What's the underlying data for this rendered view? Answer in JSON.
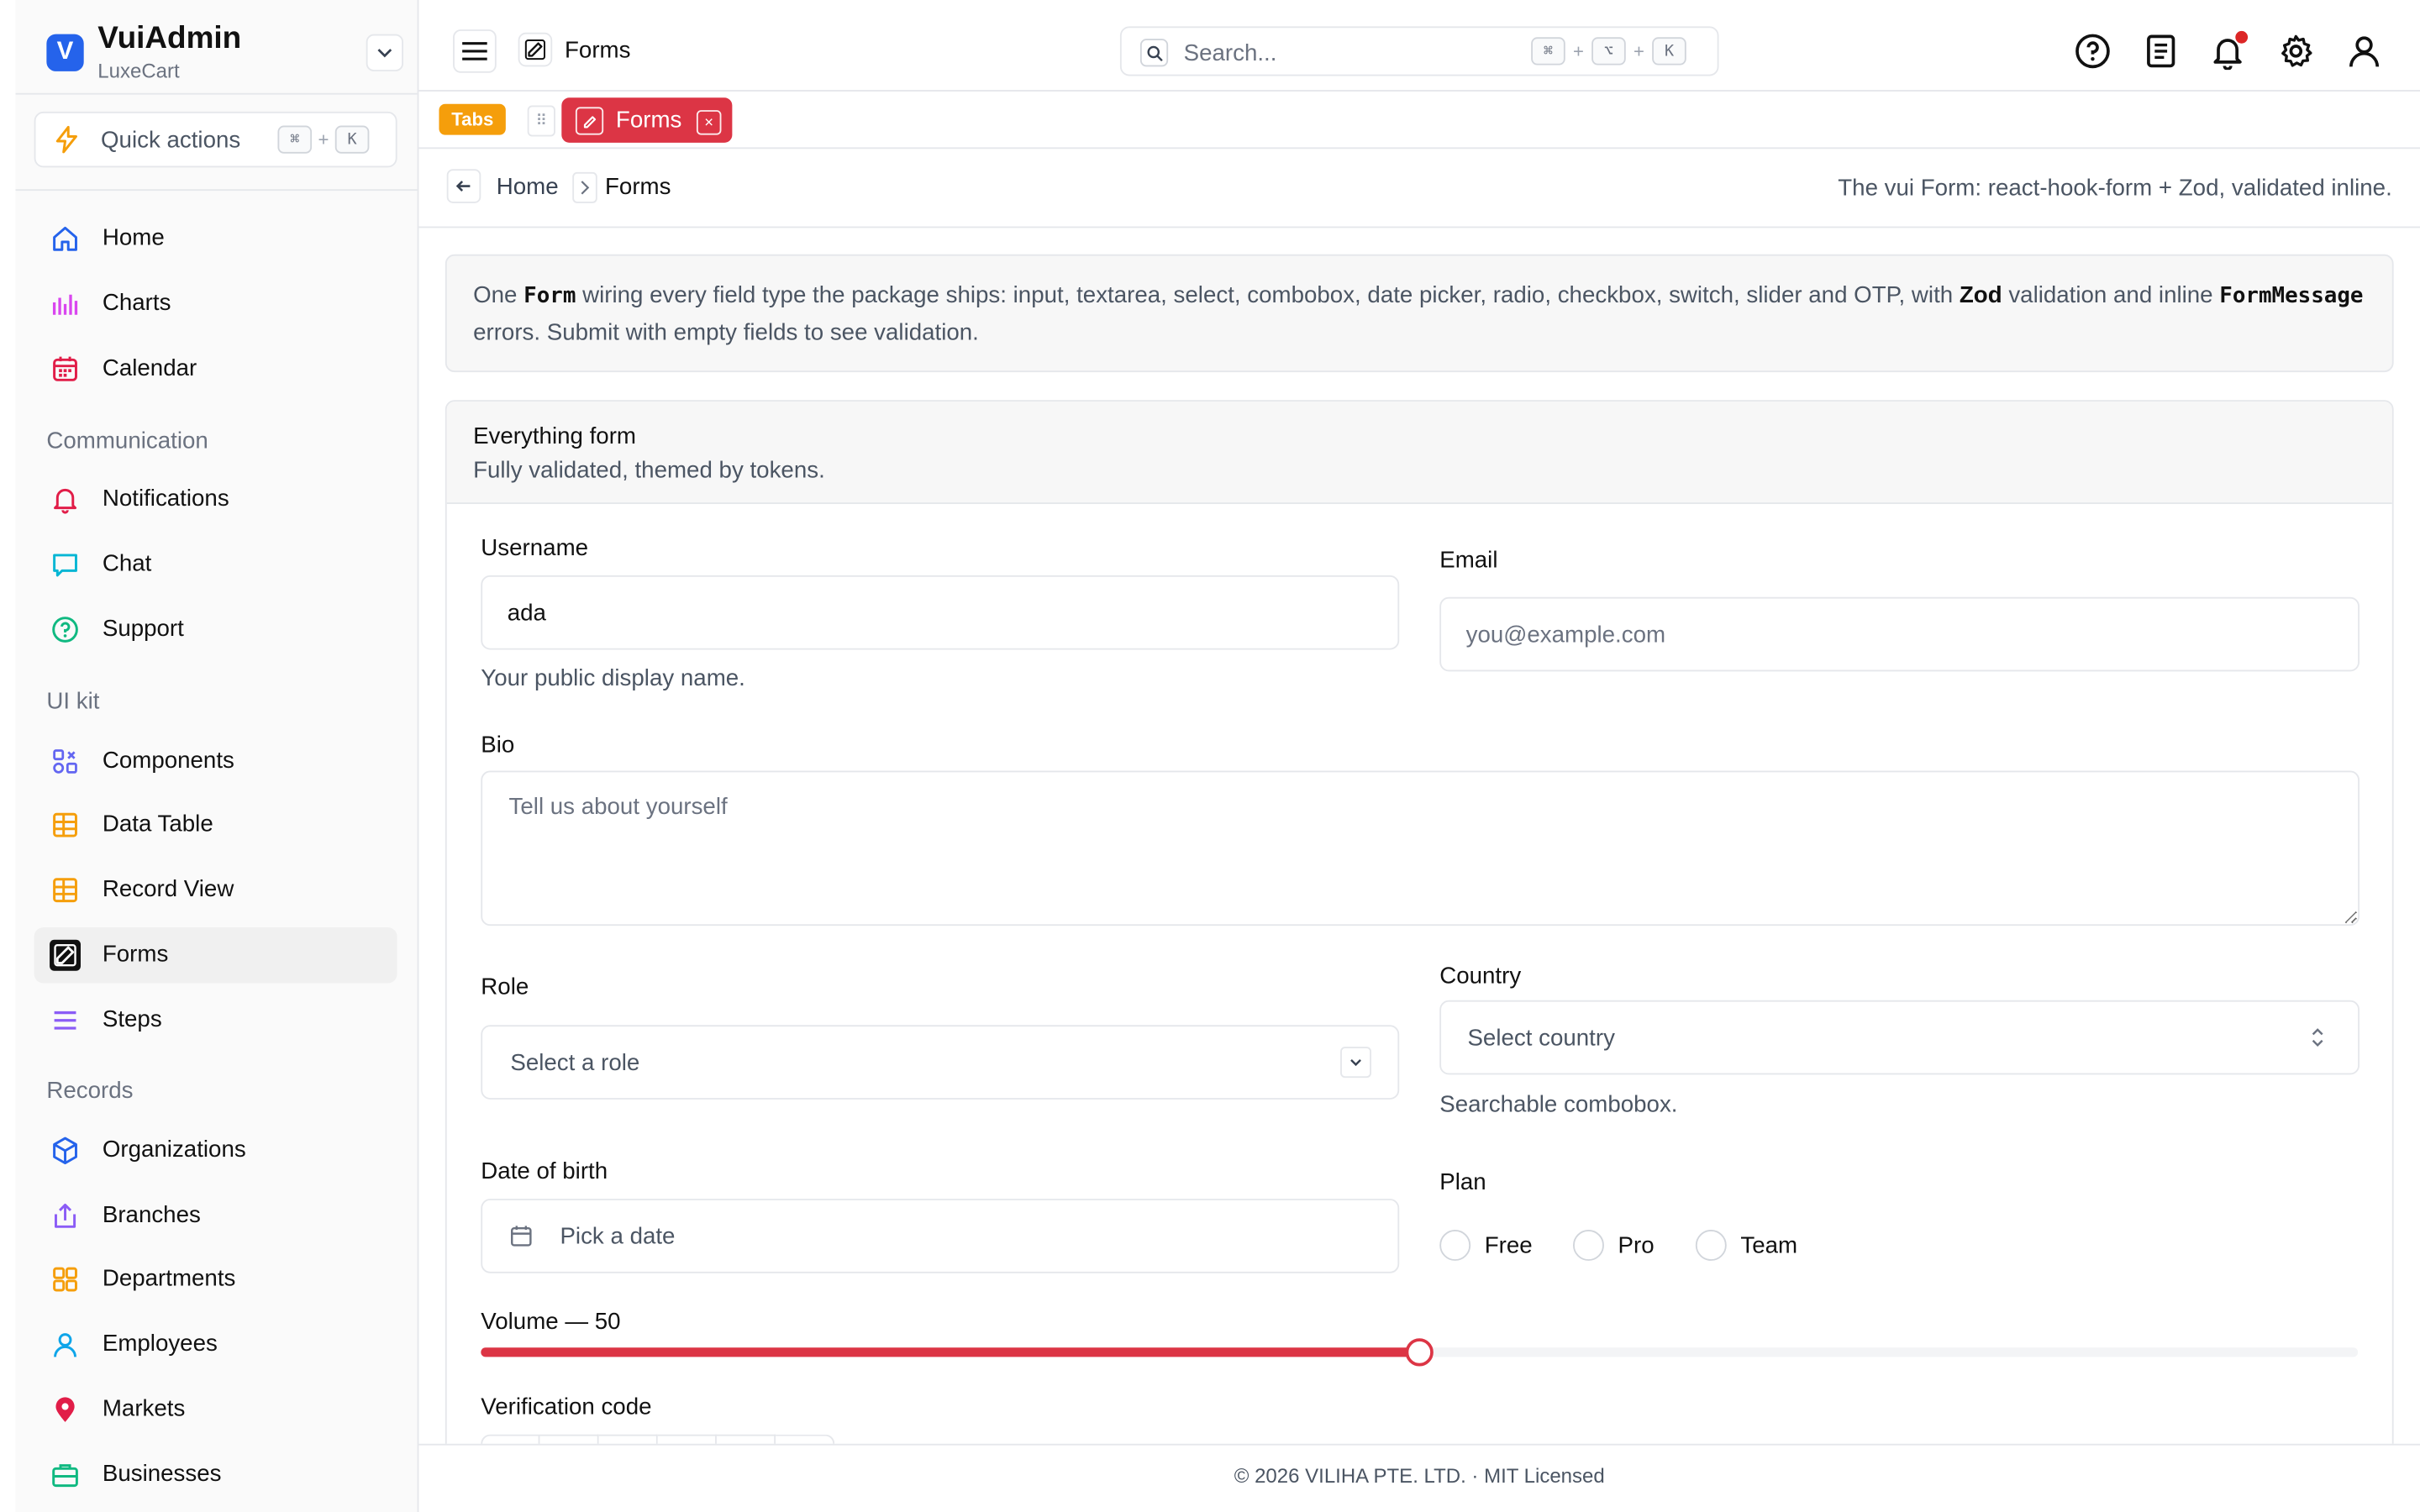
{
  "app": {
    "name": "VuiAdmin",
    "workspace": "LuxeCart",
    "brand_letter": "V"
  },
  "quick_actions": {
    "label": "Quick actions",
    "kbd": [
      "⌘",
      "K"
    ],
    "plus": "+"
  },
  "sidebar": {
    "items_top": [
      {
        "label": "Home",
        "icon": "home-icon",
        "color": "#2563eb"
      },
      {
        "label": "Charts",
        "icon": "chart-icon",
        "color": "#d946ef"
      },
      {
        "label": "Calendar",
        "icon": "calendar-icon",
        "color": "#e11d48"
      }
    ],
    "communication": {
      "title": "Communication",
      "items": [
        {
          "label": "Notifications",
          "icon": "bell-icon",
          "color": "#e11d48"
        },
        {
          "label": "Chat",
          "icon": "chat-icon",
          "color": "#06b6d4"
        },
        {
          "label": "Support",
          "icon": "help-icon",
          "color": "#10b981"
        }
      ]
    },
    "uikit": {
      "title": "UI kit",
      "items": [
        {
          "label": "Components",
          "icon": "components-icon",
          "color": "#6366f1"
        },
        {
          "label": "Data Table",
          "icon": "table-icon",
          "color": "#f59e0b"
        },
        {
          "label": "Record View",
          "icon": "record-icon",
          "color": "#f59e0b"
        },
        {
          "label": "Forms",
          "icon": "edit-icon",
          "color": "#111111",
          "active": true
        },
        {
          "label": "Steps",
          "icon": "steps-icon",
          "color": "#8b5cf6"
        }
      ]
    },
    "records": {
      "title": "Records",
      "items": [
        {
          "label": "Organizations",
          "icon": "box-icon",
          "color": "#2563eb"
        },
        {
          "label": "Branches",
          "icon": "branch-icon",
          "color": "#8b5cf6"
        },
        {
          "label": "Departments",
          "icon": "grid-icon",
          "color": "#f59e0b"
        },
        {
          "label": "Employees",
          "icon": "user-icon",
          "color": "#0ea5e9"
        },
        {
          "label": "Markets",
          "icon": "pin-icon",
          "color": "#e11d48"
        },
        {
          "label": "Businesses",
          "icon": "briefcase-icon",
          "color": "#10b981"
        }
      ]
    }
  },
  "topbar": {
    "page_title": "Forms",
    "search": {
      "placeholder": "Search...",
      "kbd": [
        "⌘",
        "⌥",
        "K"
      ],
      "plus": "+"
    },
    "icons": [
      "help-icon",
      "docs-icon",
      "bell-icon",
      "gear-icon",
      "user-icon"
    ]
  },
  "tabs": {
    "badge": "Tabs",
    "active": "Forms",
    "close": "×"
  },
  "breadcrumb": {
    "home": "Home",
    "current": "Forms",
    "description": "The vui Form: react-hook-form + Zod, validated inline."
  },
  "intro": {
    "p1": "One ",
    "code1": "Form",
    "p2": " wiring every field type the package ships: input, textarea, select, combobox, date picker, radio, checkbox, switch, slider and OTP, with ",
    "bold": "Zod",
    "p3": " validation and inline ",
    "code2": "FormMessage",
    "p4": " errors. Submit with empty fields to see validation."
  },
  "form": {
    "title": "Everything form",
    "description": "Fully validated, themed by tokens.",
    "username": {
      "label": "Username",
      "value": "ada",
      "hint": "Your public display name."
    },
    "email": {
      "label": "Email",
      "placeholder": "you@example.com"
    },
    "bio": {
      "label": "Bio",
      "placeholder": "Tell us about yourself"
    },
    "role": {
      "label": "Role",
      "placeholder": "Select a role"
    },
    "country": {
      "label": "Country",
      "placeholder": "Select country",
      "hint": "Searchable combobox."
    },
    "dob": {
      "label": "Date of birth",
      "placeholder": "Pick a date"
    },
    "plan": {
      "label": "Plan",
      "options": [
        "Free",
        "Pro",
        "Team"
      ]
    },
    "volume": {
      "label": "Volume — 50",
      "value": 50,
      "max": 100
    },
    "verification": {
      "label": "Verification code",
      "digits": 6
    }
  },
  "footer": {
    "text": "© 2026 VILIHA PTE. LTD. · MIT Licensed"
  },
  "colors": {
    "accent": "#dc3545",
    "brand": "#2563eb",
    "tabs_badge": "#f59e0b"
  }
}
